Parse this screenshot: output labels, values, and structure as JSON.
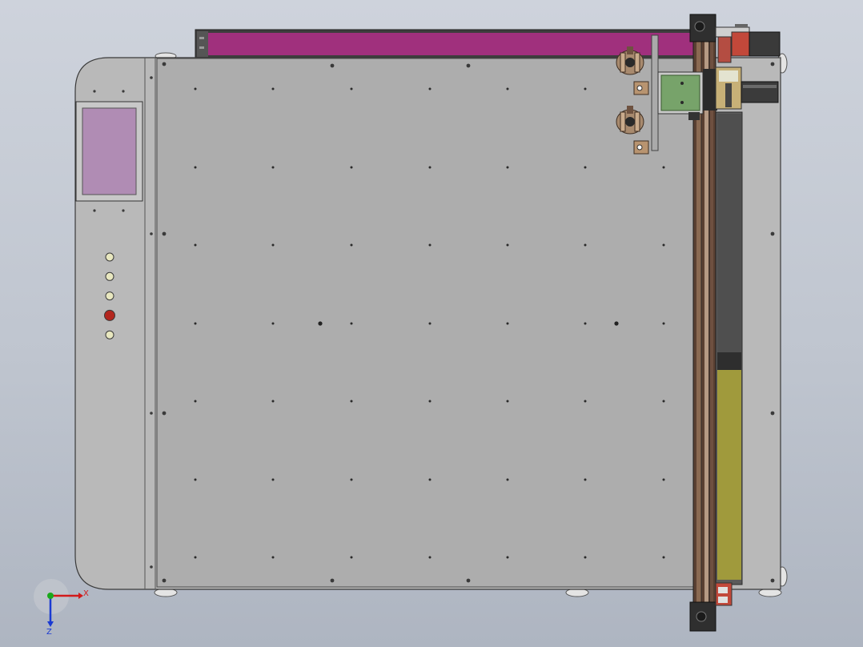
{
  "colors": {
    "background_top": "#ced3dc",
    "background_bottom": "#aeb5c1",
    "machine_body": "#b9b9b9",
    "cutting_table": "#adadad",
    "outline": "#3a3a3a",
    "screen": "#b08cb4",
    "top_rail": "#a0307d",
    "gantry_beam": "#7a5a44",
    "tool_head": "#77a36a",
    "conveyor_dark": "#4f4f4f",
    "conveyor_yellow": "#a09a3c",
    "brass_fitting": "#a88a6e",
    "button_active": "#b3261e",
    "button_idle": "#e8e7bf",
    "axis_x": "#d21a1a",
    "axis_y": "#1aa81a",
    "axis_z": "#1a3ad2"
  },
  "control_panel": {
    "buttons": [
      {
        "name": "button-1",
        "state": "idle"
      },
      {
        "name": "button-2",
        "state": "idle"
      },
      {
        "name": "button-3",
        "state": "idle"
      },
      {
        "name": "button-4",
        "state": "active"
      },
      {
        "name": "button-5",
        "state": "idle"
      }
    ]
  },
  "orientation_triad": {
    "x_label": "X",
    "z_label": "Z",
    "icons": [
      "axis-x-arrow-icon",
      "axis-y-arrow-icon",
      "axis-z-arrow-icon"
    ]
  }
}
